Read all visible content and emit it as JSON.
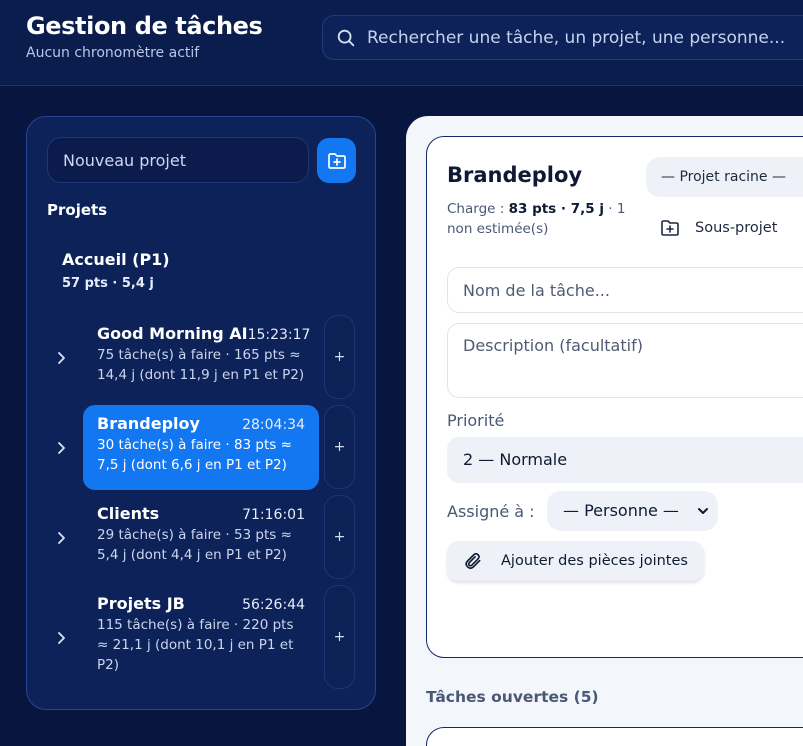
{
  "header": {
    "title": "Gestion de tâches",
    "subtitle": "Aucun chronomètre actif",
    "search_placeholder": "Rechercher une tâche, un projet, une personne..."
  },
  "sidebar": {
    "new_project_placeholder": "Nouveau projet",
    "section_label": "Projets",
    "root": {
      "name": "Accueil (P1)",
      "meta": "57 pts · 5,4 j"
    },
    "projects": [
      {
        "name": "Good Morning AI",
        "time": "15:23:17",
        "meta": "75 tâche(s) à faire · 165 pts ≈ 14,4 j (dont 11,9 j en P1 et P2)",
        "active": false
      },
      {
        "name": "Brandeploy",
        "time": "28:04:34",
        "meta": "30 tâche(s) à faire · 83 pts ≈ 7,5 j (dont 6,6 j en P1 et P2)",
        "active": true
      },
      {
        "name": "Clients",
        "time": "71:16:01",
        "meta": "29 tâche(s) à faire · 53 pts ≈ 5,4 j (dont 4,4 j en P1 et P2)",
        "active": false
      },
      {
        "name": "Projets JB",
        "time": "56:26:44",
        "meta": "115 tâche(s) à faire · 220 pts ≈ 21,1 j (dont 10,1 j en P1 et P2)",
        "active": false
      }
    ],
    "plus_label": "+"
  },
  "project_form": {
    "title": "Brandeploy",
    "charge_prefix": "Charge : ",
    "charge_bold": "83 pts · 7,5 j",
    "charge_suffix": " · 1 non estimée(s)",
    "parent_select": "— Projet racine —",
    "subproject_label": "Sous-projet",
    "task_name_placeholder": "Nom de la tâche...",
    "description_placeholder": "Description (facultatif)",
    "priority_label": "Priorité",
    "priority_value": "2 — Normale",
    "assign_label": "Assigné à :",
    "assign_value": "— Personne —",
    "attach_label": "Ajouter des pièces jointes"
  },
  "open_tasks_label": "Tâches ouvertes (5)",
  "colors": {
    "background": "#07153f",
    "panel": "#0d2258",
    "accent": "#1277f0",
    "content_bg": "#f3f6fb"
  }
}
